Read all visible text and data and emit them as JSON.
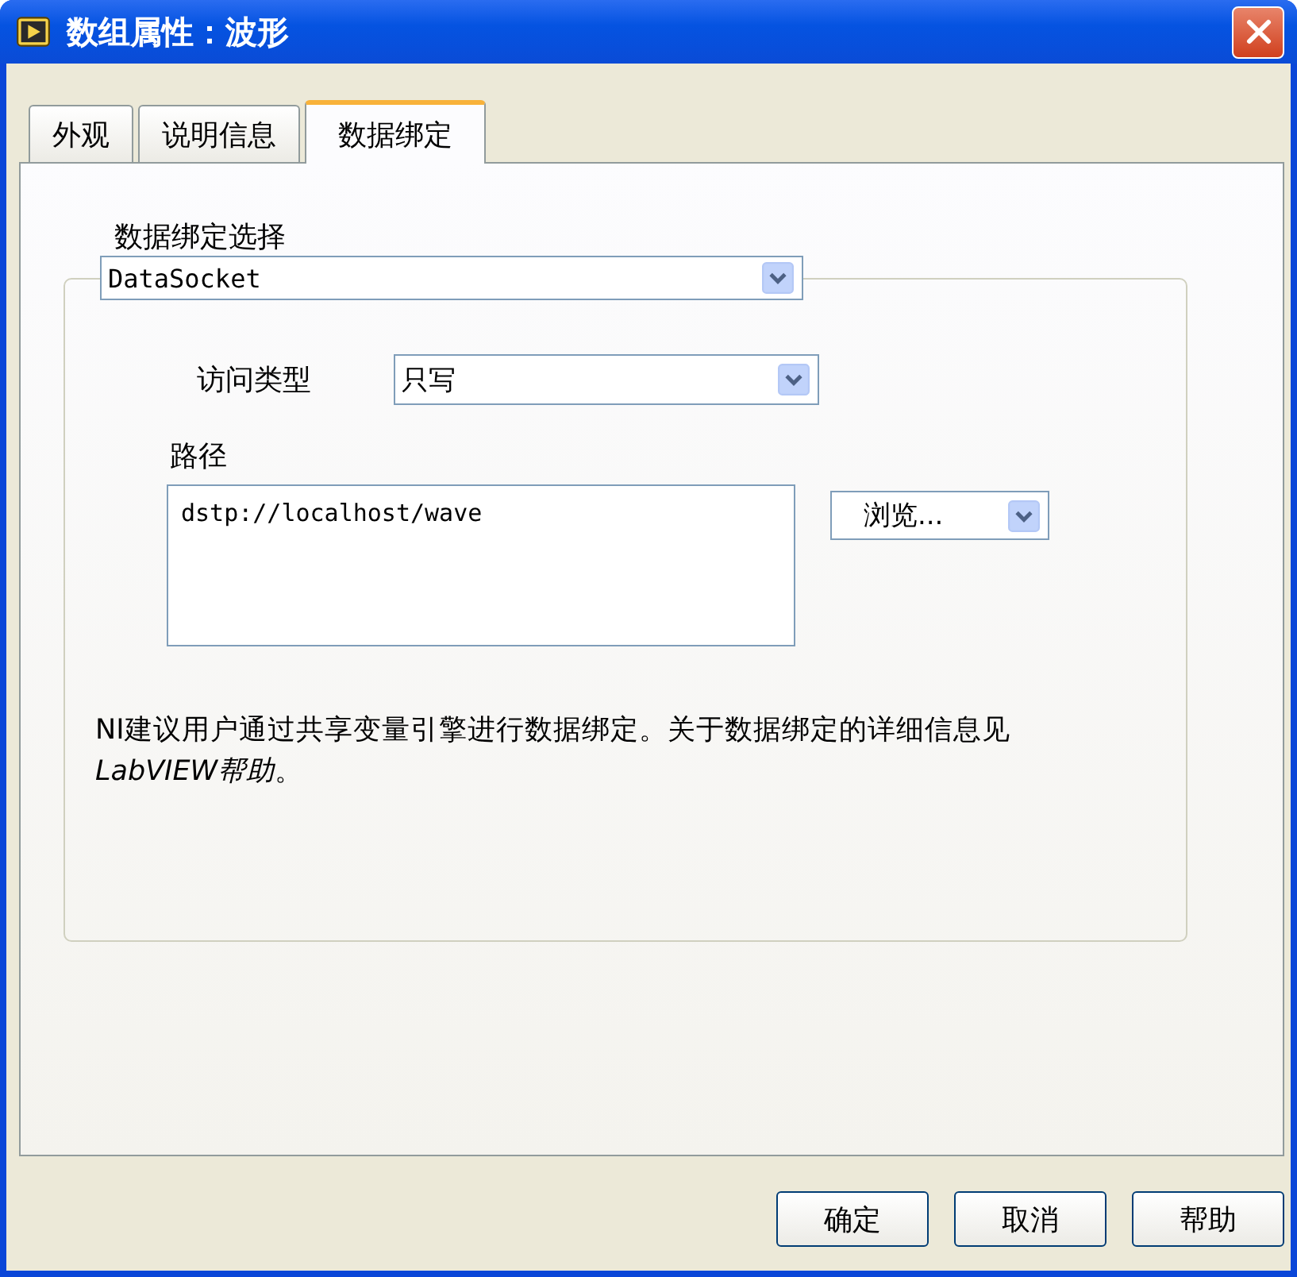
{
  "window": {
    "title": "数组属性：波形"
  },
  "tabs": [
    {
      "label": "外观",
      "selected": false
    },
    {
      "label": "说明信息",
      "selected": false
    },
    {
      "label": "数据绑定",
      "selected": true
    }
  ],
  "binding": {
    "label": "数据绑定选择",
    "value": "DataSocket"
  },
  "access": {
    "label": "访问类型",
    "value": "只写"
  },
  "path": {
    "label": "路径",
    "value": "dstp://localhost/wave",
    "browse": "浏览..."
  },
  "note": {
    "text": "NI建议用户通过共享变量引擎进行数据绑定。关于数据绑定的详细信息见",
    "link": "LabVIEW帮助",
    "tail": "。"
  },
  "buttons": [
    "确定",
    "取消",
    "帮助"
  ]
}
